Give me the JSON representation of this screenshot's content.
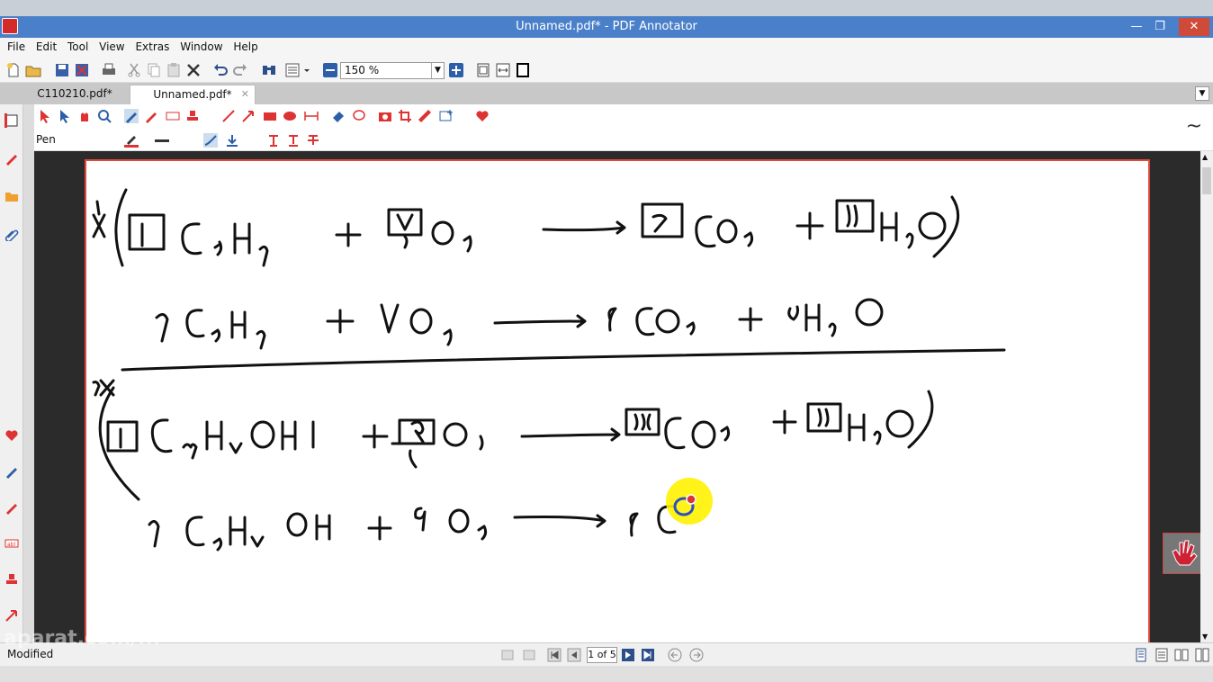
{
  "window": {
    "title": "Unnamed.pdf* - PDF Annotator",
    "minimize": "—",
    "maximize": "❐",
    "close": "✕"
  },
  "menu": [
    "File",
    "Edit",
    "Tool",
    "View",
    "Extras",
    "Window",
    "Help"
  ],
  "toolbar": {
    "zoom_value": "150 %"
  },
  "tabs": [
    {
      "label": "C110210.pdf*"
    },
    {
      "label": "Unnamed.pdf*"
    }
  ],
  "annotation_toolbar": {
    "current_tool_label": "Pen"
  },
  "document": {
    "equations_handwritten": true
  },
  "status": {
    "text": "Modified",
    "page_indicator": "1 of 5",
    "watermark": "aparat.com/..."
  },
  "colors": {
    "titlebar": "#4a80c9",
    "page_border": "#e04a3a",
    "ink": "#111111",
    "highlight_cursor": "#ffee00"
  }
}
